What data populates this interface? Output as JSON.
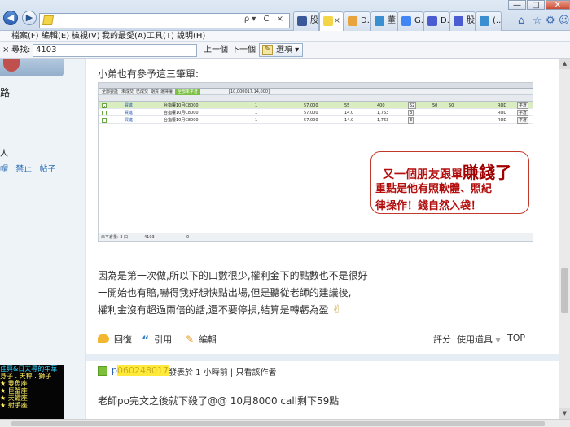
{
  "browser": {
    "address": {
      "url": "",
      "tools": "ρ▾ C ×"
    },
    "tabs": [
      {
        "label": "股...",
        "icon_color": "#3b5998",
        "active": false
      },
      {
        "label": "",
        "icon_color": "#f4d547",
        "active": true,
        "close": "×"
      },
      {
        "label": "D...",
        "icon_color": "#e8a33c",
        "active": false
      },
      {
        "label": "董...",
        "icon_color": "#3a8fd1",
        "active": false
      },
      {
        "label": "G...",
        "icon_color": "#4285f4",
        "active": false
      },
      {
        "label": "D...",
        "icon_color": "#4b5bd1",
        "active": false
      },
      {
        "label": "股...",
        "icon_color": "#4b5bd1",
        "active": false
      },
      {
        "label": "(...",
        "icon_color": "#3a8fd1",
        "active": false
      }
    ],
    "window_controls": {
      "minimize": "—",
      "maximize": "□",
      "close": "✕"
    },
    "icons": {
      "home": "home-icon",
      "favorites": "star-icon",
      "settings": "gear-icon",
      "smile": "smiley-icon"
    }
  },
  "menu": [
    "檔案(F)",
    "編輯(E)",
    "檢視(V)",
    "我的最愛(A)",
    "工具(T)",
    "說明(H)"
  ],
  "findbar": {
    "close": "×",
    "label": "尋找:",
    "value": "4103",
    "prev": "上一個",
    "next": "下一個",
    "options": "選項 ▾"
  },
  "sidebar": {
    "road": "路",
    "person": "人",
    "links": [
      "帽",
      "禁止",
      "帖子"
    ],
    "signature": {
      "title": "佳興&日天尋的年華",
      "rows": [
        "身子 . 天秤 . 獅子",
        "★ 雙魚座",
        "★ 巨蟹座",
        "★ 天蠍座",
        "★ 射手座"
      ]
    }
  },
  "post": {
    "intro": "小弟也有參予這三筆單:",
    "lines": [
      "因為是第一次做,所以下的口數很少,權利金下的點數也不是很好",
      "一開始也有賠,嚇得我好想快點出場,但是聽從老師的建議後,",
      "權利金沒有超過兩倍的話,還不要停損,結算是轉虧為盈"
    ],
    "embed": {
      "filter_labels": [
        "全部委託",
        "未成交",
        "已成交",
        "期貨",
        "選擇權",
        "全部未平倉",
        "[10,000017.14,000]"
      ],
      "rows": [
        {
          "mark": "✓",
          "code": "買進",
          "name": "台指權10月C8000",
          "qty": "1",
          "price": "57.000",
          "value": "55",
          "p2": "400",
          "p3": "52",
          "p4": "50",
          "p5": "50",
          "tag": "ROD",
          "act": "平倉",
          "hl": true
        },
        {
          "mark": "",
          "code": "買進",
          "name": "台指權10月C8000",
          "qty": "1",
          "price": "57.000",
          "value": "14.0",
          "p2": "1,763",
          "p3": "3",
          "p4": "",
          "p5": "",
          "tag": "ROD",
          "act": "平倉",
          "hl": false
        },
        {
          "mark": "",
          "code": "買進",
          "name": "台指權10月C8000",
          "qty": "1",
          "price": "57.000",
          "value": "14.0",
          "p2": "1,763",
          "p3": "3",
          "p4": "",
          "p5": "",
          "tag": "ROD",
          "act": "平倉",
          "hl": false
        }
      ],
      "status": [
        "未平倉量: 3 口",
        "4103",
        "0"
      ]
    },
    "callout": {
      "line1_prefix": "又一個朋友跟單",
      "line1_big": "賺錢了",
      "line2": "重點是他有照軟體、照紀",
      "line3": "律操作！錢自然入袋！"
    },
    "actions": {
      "reply": "回復",
      "quote": "引用",
      "edit": "編輯",
      "rate": "評分",
      "tools": "使用道具",
      "top": "TOP"
    }
  },
  "reply": {
    "user_prefix": "p",
    "user_masked": "060248017",
    "posted": "發表於 1 小時前",
    "sep": "|",
    "author_only": "只看該作者",
    "text": "老師po完文之後就下殺了@@ 10月8000 call剩下59點"
  },
  "scrollbar": {
    "up": "▲",
    "down": "▼"
  }
}
